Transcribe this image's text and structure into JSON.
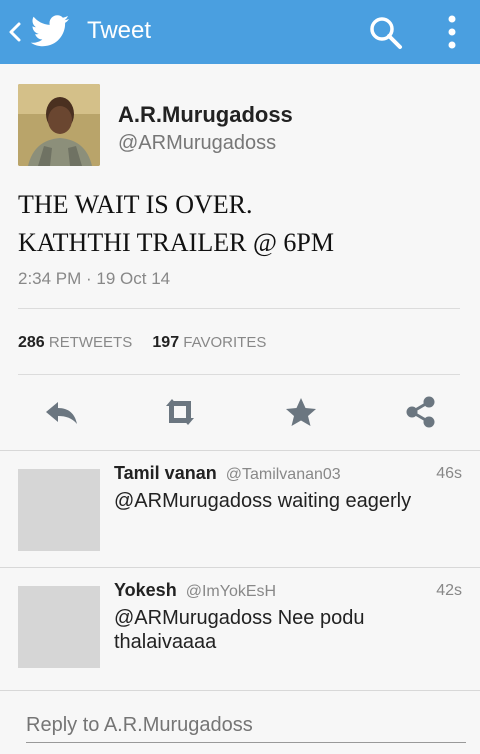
{
  "topbar": {
    "title": "Tweet",
    "back_icon": "chevron-left-icon",
    "logo_icon": "twitter-bird-icon",
    "search_icon": "search-icon",
    "menu_icon": "overflow-menu-icon",
    "color": "#4a9fe0"
  },
  "tweet": {
    "author_name": "A.R.Murugadoss",
    "author_handle": "@ARMurugadoss",
    "text_lines": [
      "THE WAIT IS OVER.",
      "KATHTHI TRAILER @ 6PM"
    ],
    "timestamp": "2:34 PM · 19 Oct 14",
    "retweets_count": "286",
    "retweets_label": "RETWEETS",
    "favorites_count": "197",
    "favorites_label": "FAVORITES",
    "actions": [
      "reply-icon",
      "retweet-icon",
      "favorite-star-icon",
      "share-icon"
    ]
  },
  "replies": [
    {
      "name": "Tamil vanan",
      "handle": "@Tamilvanan03",
      "time": "46s",
      "text": "@ARMurugadoss waiting eagerly"
    },
    {
      "name": "Yokesh",
      "handle": "@ImYokEsH",
      "time": "42s",
      "text": "@ARMurugadoss Nee podu thalaivaaaa"
    }
  ],
  "reply_box": {
    "placeholder": "Reply to A.R.Murugadoss"
  }
}
